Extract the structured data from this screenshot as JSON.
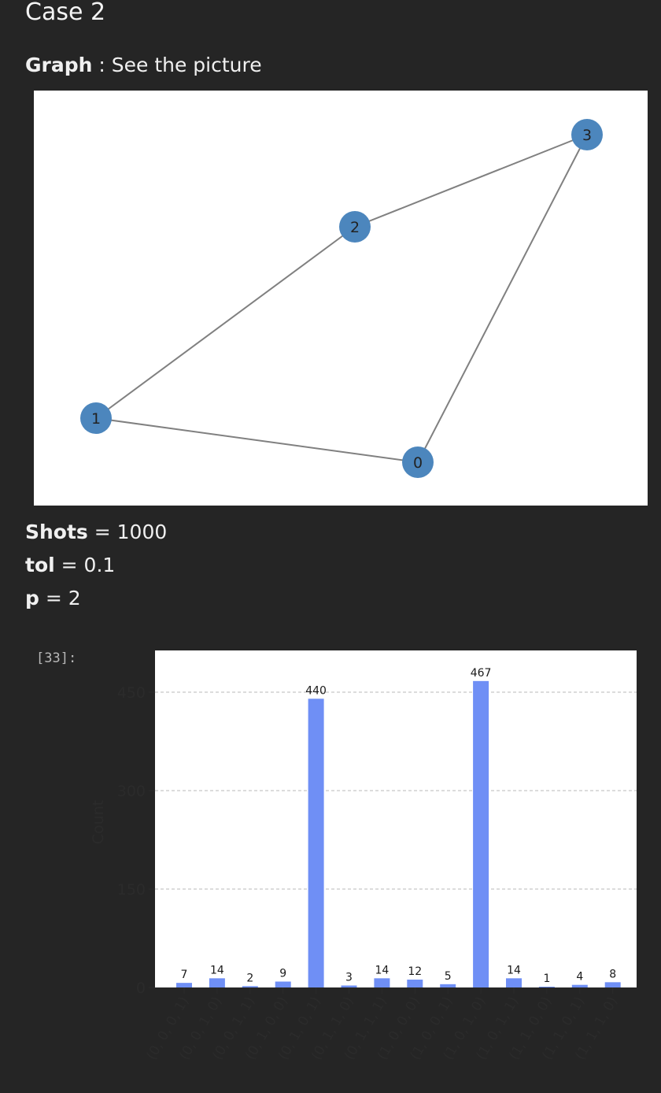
{
  "section": {
    "title": "Case 2",
    "graph_label": "Graph",
    "graph_text": " : See the picture"
  },
  "graph": {
    "node_color": "#4c86bd",
    "edge_color": "#808080",
    "nodes": [
      {
        "id": "0",
        "label": "0"
      },
      {
        "id": "1",
        "label": "1"
      },
      {
        "id": "2",
        "label": "2"
      },
      {
        "id": "3",
        "label": "3"
      }
    ],
    "edges": [
      [
        "1",
        "2"
      ],
      [
        "2",
        "3"
      ],
      [
        "3",
        "0"
      ],
      [
        "0",
        "1"
      ]
    ]
  },
  "params": {
    "shots_label": "Shots",
    "shots_value": " = 1000",
    "tol_label": "tol",
    "tol_value": " = 0.1",
    "p_label": "p",
    "p_value": " = 2"
  },
  "cell": {
    "prompt": "[33]:"
  },
  "chart_data": {
    "type": "bar",
    "ylabel": "Count",
    "ylim": [
      0,
      500
    ],
    "yticks": [
      0,
      150,
      300,
      450
    ],
    "grid": true,
    "bar_color": "#6f8ff5",
    "categories": [
      "(0, 0, 0, 1)",
      "(0, 0, 1, 0)",
      "(0, 0, 1, 1)",
      "(0, 1, 0, 0)",
      "(0, 1, 0, 1)",
      "(0, 1, 1, 0)",
      "(0, 1, 1, 1)",
      "(1, 0, 0, 0)",
      "(1, 0, 0, 1)",
      "(1, 0, 1, 0)",
      "(1, 0, 1, 1)",
      "(1, 1, 0, 0)",
      "(1, 1, 0, 1)",
      "(1, 1, 1, 0)"
    ],
    "values": [
      7,
      14,
      2,
      9,
      440,
      3,
      14,
      12,
      5,
      467,
      14,
      1,
      4,
      8
    ]
  }
}
